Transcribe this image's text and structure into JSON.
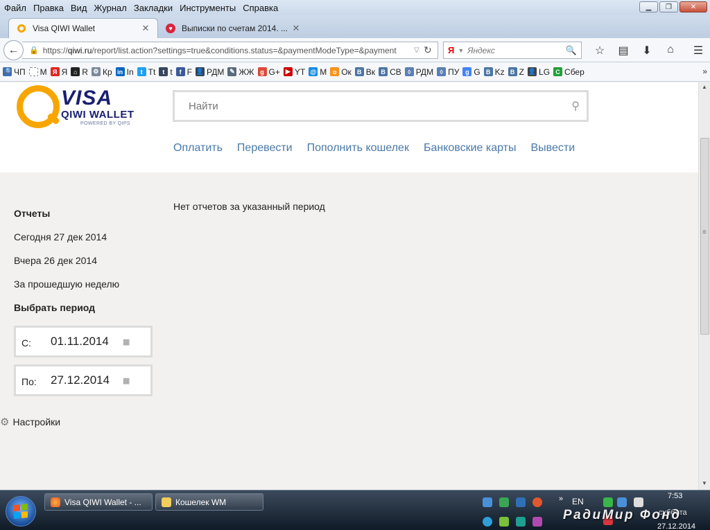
{
  "menubar": {
    "items": [
      "Файл",
      "Правка",
      "Вид",
      "Журнал",
      "Закладки",
      "Инструменты",
      "Справка"
    ]
  },
  "tabs": [
    {
      "title": "Visa QIWI Wallet",
      "favicon": "qiwi-icon"
    },
    {
      "title": "Выписки по счетам 2014. ...",
      "favicon": "heart-icon"
    }
  ],
  "address": {
    "url_prefix": "https://",
    "url_domain": "qiwi.ru",
    "url_path": "/report/list.action?settings=true&conditions.status=&paymentModeType=&payment"
  },
  "browser_search": {
    "engine_letter": "Я",
    "placeholder": "Яндекс"
  },
  "bookmarks": [
    {
      "label": "ЧП",
      "color": "#3d6fb6",
      "glyph": "🔎"
    },
    {
      "label": "М",
      "color": "#ffffff",
      "glyph": ""
    },
    {
      "label": "Я",
      "color": "#e02424",
      "glyph": "Я"
    },
    {
      "label": "R",
      "color": "#222222",
      "glyph": "⌂"
    },
    {
      "label": "Кр",
      "color": "#7a8a99",
      "glyph": "⚙"
    },
    {
      "label": "In",
      "color": "#0a66c2",
      "glyph": "in"
    },
    {
      "label": "Tt",
      "color": "#1da1f2",
      "glyph": "t"
    },
    {
      "label": "t",
      "color": "#35465c",
      "glyph": "t"
    },
    {
      "label": "F",
      "color": "#3b5998",
      "glyph": "f"
    },
    {
      "label": "РДМ",
      "color": "#334455",
      "glyph": "👤"
    },
    {
      "label": "ЖЖ",
      "color": "#5a6b7c",
      "glyph": "✎"
    },
    {
      "label": "G+",
      "color": "#dd4b39",
      "glyph": "g"
    },
    {
      "label": "YT",
      "color": "#cc0000",
      "glyph": "▶"
    },
    {
      "label": "М",
      "color": "#168de2",
      "glyph": "@"
    },
    {
      "label": "Ок",
      "color": "#f7931e",
      "glyph": "о"
    },
    {
      "label": "Вк",
      "color": "#4c75a3",
      "glyph": "В"
    },
    {
      "label": "СВ",
      "color": "#4c75a3",
      "glyph": "В"
    },
    {
      "label": "РДМ",
      "color": "#5b7fb5",
      "glyph": "◊"
    },
    {
      "label": "ПУ",
      "color": "#5b7fb5",
      "glyph": "◊"
    },
    {
      "label": "G",
      "color": "#4285f4",
      "glyph": "g"
    },
    {
      "label": "Kz",
      "color": "#4c75a3",
      "glyph": "В"
    },
    {
      "label": "Z",
      "color": "#4c75a3",
      "glyph": "В"
    },
    {
      "label": "LG",
      "color": "#444444",
      "glyph": "👤"
    },
    {
      "label": "Сбер",
      "color": "#21a038",
      "glyph": "С"
    }
  ],
  "site": {
    "logo": {
      "visa": "VISA",
      "wallet": "QIWI WALLET",
      "powered": "POWERED BY QIPS"
    },
    "search_placeholder": "Найти",
    "nav": [
      "Оплатить",
      "Перевести",
      "Пополнить кошелек",
      "Банковские карты",
      "Вывести"
    ]
  },
  "sidebar": {
    "reports_heading": "Отчеты",
    "today": "Сегодня 27 дек 2014",
    "yesterday": "Вчера 26 дек 2014",
    "last_week": "За прошедшую неделю",
    "choose_period": "Выбрать период",
    "from_label": "С:",
    "from_value": "01.11.2014",
    "to_label": "По:",
    "to_value": "27.12.2014",
    "settings": "Настройки"
  },
  "content": {
    "empty_message": "Нет отчетов за указанный период"
  },
  "taskbar": {
    "buttons": [
      {
        "label": "Visa QIWI Wallet - ...",
        "icon": "firefox-icon"
      },
      {
        "label": "Кошелек WM",
        "icon": "folder-icon"
      }
    ],
    "language": "EN",
    "time": "7:53",
    "day": "суббота",
    "date": "27.12.2014",
    "watermark": "РадиМир Фонд"
  }
}
